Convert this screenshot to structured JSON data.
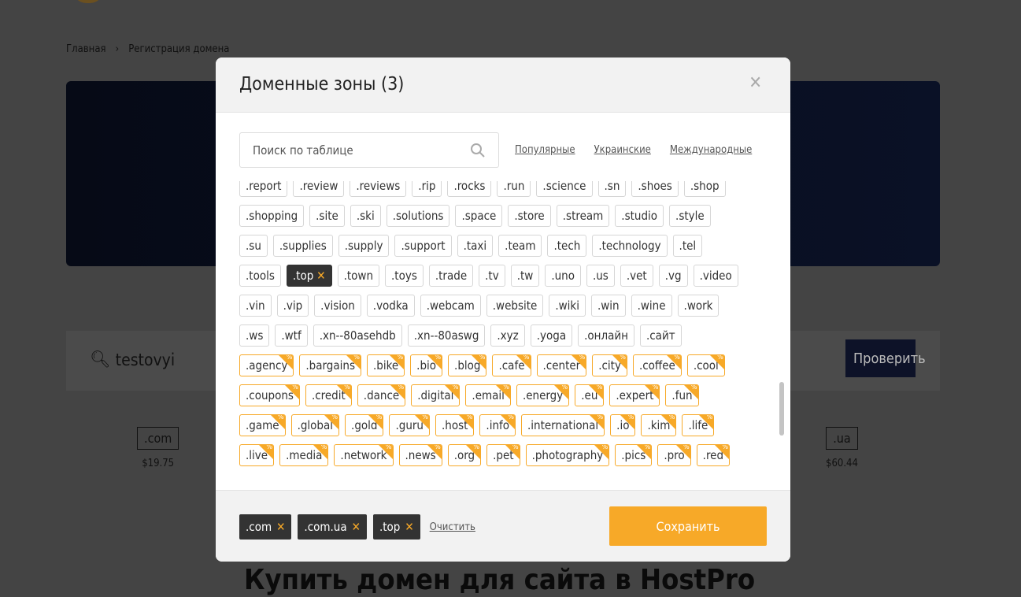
{
  "page": {
    "breadcrumb": [
      "Главная",
      "Регистрация домена"
    ],
    "search_value": "testovyi",
    "check_label": "Проверить",
    "zones": [
      {
        "name": ".com",
        "price": "$19.75"
      },
      {
        "name": ".ua",
        "price": "$60.44"
      }
    ],
    "heading": "Купить домен для сайта в HostPro"
  },
  "modal": {
    "title": "Доменные зоны (3)",
    "search_placeholder": "Поиск по таблице",
    "filters": [
      "Популярные",
      "Украинские",
      "Международные"
    ],
    "promo_badge": "%",
    "accent_color": "#f7a928",
    "rows": [
      {
        "promo": false,
        "tags": [
          ".report",
          ".review",
          ".reviews",
          ".rip",
          ".rocks",
          ".run",
          ".science",
          ".sn",
          ".shoes",
          ".shop"
        ]
      },
      {
        "promo": false,
        "tags": [
          ".shopping",
          ".site",
          ".ski",
          ".solutions",
          ".space",
          ".store",
          ".stream",
          ".studio",
          ".style"
        ]
      },
      {
        "promo": false,
        "tags": [
          ".su",
          ".supplies",
          ".supply",
          ".support",
          ".taxi",
          ".team",
          ".tech",
          ".technology",
          ".tel"
        ]
      },
      {
        "promo": false,
        "tags": [
          ".tools",
          ".top",
          ".town",
          ".toys",
          ".trade",
          ".tv",
          ".tw",
          ".uno",
          ".us",
          ".vet",
          ".vg",
          ".video"
        ],
        "selected": [
          ".top"
        ]
      },
      {
        "promo": false,
        "tags": [
          ".vin",
          ".vip",
          ".vision",
          ".vodka",
          ".webcam",
          ".website",
          ".wiki",
          ".win",
          ".wine",
          ".work"
        ]
      },
      {
        "promo": false,
        "tags": [
          ".ws",
          ".wtf",
          ".xn--80asehdb",
          ".xn--80aswg",
          ".xyz",
          ".yoga",
          ".онлайн",
          ".сайт"
        ]
      },
      {
        "promo": true,
        "tags": [
          ".agency",
          ".bargains",
          ".bike",
          ".bio",
          ".blog",
          ".cafe",
          ".center",
          ".city",
          ".coffee",
          ".cool"
        ]
      },
      {
        "promo": true,
        "tags": [
          ".coupons",
          ".credit",
          ".dance",
          ".digital",
          ".email",
          ".energy",
          ".eu",
          ".expert",
          ".fun"
        ]
      },
      {
        "promo": true,
        "tags": [
          ".game",
          ".global",
          ".gold",
          ".guru",
          ".host",
          ".info",
          ".international",
          ".io",
          ".kim",
          ".life"
        ]
      },
      {
        "promo": true,
        "tags": [
          ".live",
          ".media",
          ".network",
          ".news",
          ".org",
          ".pet",
          ".photography",
          ".pics",
          ".pro",
          ".red"
        ]
      }
    ],
    "selected": [
      ".com",
      ".com.ua",
      ".top"
    ],
    "clear_label": "Очистить",
    "save_label": "Сохранить"
  }
}
